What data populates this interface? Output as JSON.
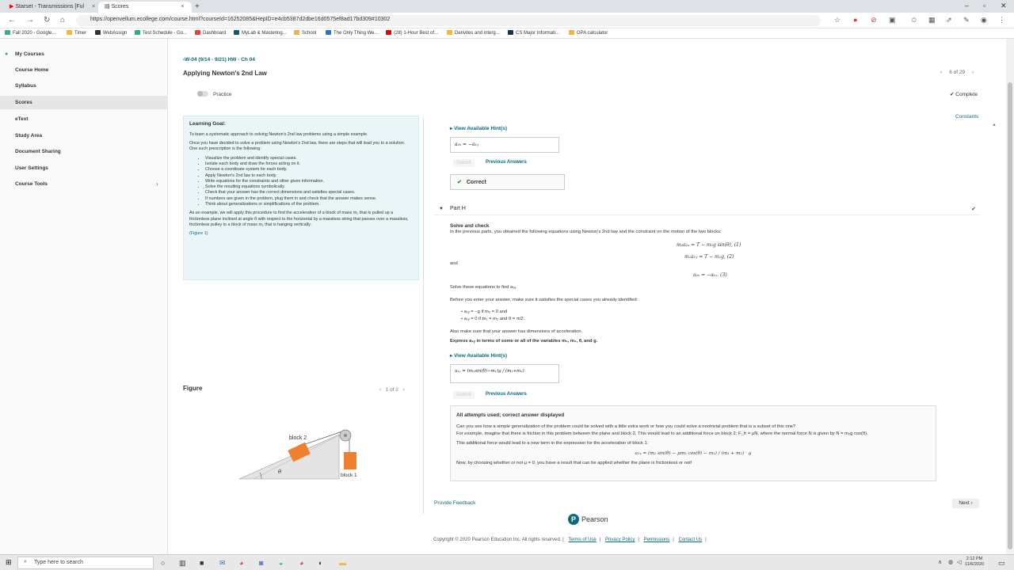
{
  "browser": {
    "tabs": [
      {
        "title": "Starset - Transmissions [Ful",
        "close": "×"
      },
      {
        "title": "Scores",
        "close": "×"
      }
    ],
    "new_tab": "+",
    "url": "https://openvellum.ecollege.com/course.html?courseId=16252085&HepID=e4cb5387d2dbe16d0575ef8ad17bd309#10302",
    "bookmarks": [
      "Fall 2020 - Google...",
      "Timer",
      "WebAssign",
      "Test Schedule - Go...",
      "Dashboard",
      "MyLab & Mastering...",
      "School",
      "The Only Thing We...",
      "(28) 1-Hour Best of...",
      "Derivites and interg...",
      "CS Major Informati...",
      "GPA calculator"
    ]
  },
  "sidebar": {
    "items": [
      "My Courses",
      "Course Home",
      "Syllabus",
      "Scores",
      "eText",
      "Study Area",
      "Document Sharing",
      "User Settings",
      "Course Tools"
    ],
    "chevron": "›"
  },
  "header": {
    "breadcrumb": "W-04 (9/14 - 9/21) HW - Ch 04",
    "title": "Applying Newton's 2nd Law",
    "pager": "6 of 29",
    "practice_label": "Practice",
    "complete_label": "Complete"
  },
  "learning_goal": {
    "heading": "Learning Goal:",
    "p1": "To learn a systematic approach to solving Newton's 2nd law problems using a simple example.",
    "p2": "Once you have decided to solve a problem using Newton's 2nd law, there are steps that will lead you to a solution. One such prescription is the following:",
    "steps": [
      "Visualize the problem and identify special cases.",
      "Isolate each body and draw the forces acting on it.",
      "Choose a coordinate system for each body.",
      "Apply Newton's 2nd law to each body.",
      "Write equations for the constraints and other given information.",
      "Solve the resulting equations symbolically.",
      "Check that your answer has the correct dimensions and satisfies special cases.",
      "If numbers are given in the problem, plug them in and check that the answer makes sense.",
      "Think about generalizations or simplifications of the problem."
    ],
    "p3": "As an example, we will apply this procedure to find the acceleration of a block of mass m₂ that is pulled up a frictionless plane inclined at angle θ with respect to the horizontal by a massless string that passes over a massless, frictionless pulley to a block of mass m₁ that is hanging vertically.",
    "figure_link": "(Figure 1)"
  },
  "figure": {
    "title": "Figure",
    "pager": "1 of 2",
    "label_block2": "block 2",
    "label_block1": "block 1",
    "label_theta": "θ"
  },
  "problem": {
    "constants": "Constants",
    "hint_label": "View Available Hint(s)",
    "prev_answer_g": "a₂ₓ = −a₁ᵧ",
    "submit": "Submit",
    "previous_answers": "Previous Answers",
    "correct": "Correct",
    "part_label": "Part H",
    "solve_check_title": "Solve and check",
    "intro": "In the previous parts, you obtained the following equations using Newton's 2nd law and the constraint on the motion of the two blocks:",
    "eq1": "m₂a₂ₓ = T − m₂g sin(θ),  (1)",
    "eq2": "m₁a₁ᵧ = T − m₁g,  (2)",
    "and": "and",
    "eq3": "a₂ₓ = −a₁ᵧ.  (3)",
    "solve_for": "Solve these equations to find a₁ᵧ.",
    "before": "Before you enter your answer, make sure it satisfies the special cases you already identified:",
    "special1": "a₁ᵧ = −g if m₂ = 0 and",
    "special2": "a₁ᵧ = 0 if m₁ = m₂ and θ = π/2.",
    "dimensions": "Also make sure that your answer has dimensions of acceleration.",
    "express": "Express a₁ᵧ in terms of some or all of the variables m₁, m₂, θ, and g.",
    "answer": "a₁ᵧ = (m₂sin(θ)−m₁)g / (m₁+m₂)",
    "result_title": "All attempts used; correct answer displayed",
    "result_p1": "Can you see how a simple generalization of the problem could be solved with a little extra work or how you could solve a nontrivial problem that is a subset of this one?",
    "result_p2": "For example, imagine that there is friction in this problem between the plane and block 2. This would lead to an additional force on block 2: F_fr = μN, where the normal force N is given by N = m₂g cos(θ).",
    "result_p3": "This additional force would lead to a new term in the expression for the acceleration of block 1:",
    "result_eq": "a₁ᵧ = (m₂ sin(θ) − μm₂ cos(θ) − m₁) / (m₁ + m₂) · g",
    "result_p4": "Now, by choosing whether or not μ = 0, you have a result that can be applied whether the plane is frictionless or not!"
  },
  "footer": {
    "feedback": "Provide Feedback",
    "next": "Next",
    "pearson": "Pearson",
    "copyright": "Copyright © 2020 Pearson Education Inc. All rights reserved. |",
    "links": [
      "Terms of Use",
      "Privacy Policy",
      "Permissions",
      "Contact Us"
    ]
  },
  "taskbar": {
    "search_placeholder": "Type here to search",
    "time": "2:12 PM",
    "date": "11/6/2020"
  },
  "colors": {
    "accent": "#0a6b7e",
    "correct_green": "#2c8c2c",
    "block": "#f08030",
    "goal_bg": "#e9f5f6"
  }
}
